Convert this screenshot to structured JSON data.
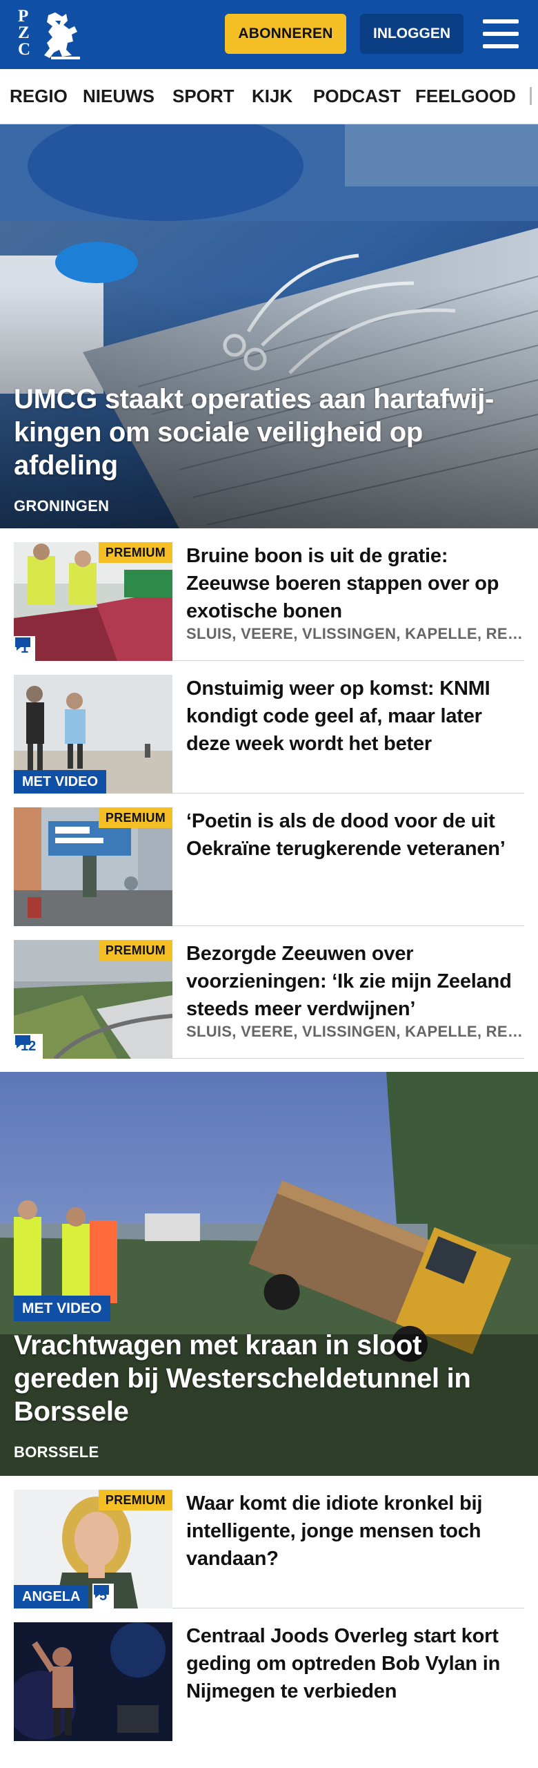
{
  "header": {
    "logo_letters": [
      "P",
      "Z",
      "C"
    ],
    "subscribe_label": "ABONNEREN",
    "login_label": "INLOGGEN",
    "brand_color": "#0f4fa6",
    "accent_color": "#f5c026"
  },
  "nav": {
    "items": [
      "REGIO",
      "NIEUWS",
      "SPORT",
      "KIJK",
      "PODCAST",
      "FEELGOOD"
    ]
  },
  "hero": {
    "title": "UMCG staakt operaties aan hartafwij-kingen om sociale veiligheid op afdeling",
    "tag": "GRONINGEN"
  },
  "articles": [
    {
      "title": "Bruine boon is uit de gratie: Zeeuwse boeren stappen over op exotische bonen",
      "meta": "SLUIS, VEERE, VLISSINGEN, KAPELLE, REIMERSWAAL",
      "premium": "PREMIUM",
      "comments": "1"
    },
    {
      "title": "Onstuimig weer op komst: KNMI kondigt code geel af, maar later deze week wordt het beter",
      "video": "MET VIDEO"
    },
    {
      "title": "‘Poetin is als de dood voor de uit Oekraïne terugkerende veteranen’",
      "premium": "PREMIUM"
    },
    {
      "title": "Bezorgde Zeeuwen over voorzieningen: ‘Ik zie mijn Zeeland steeds meer verdwijnen’",
      "meta": "SLUIS, VEERE, VLISSINGEN, KAPELLE, REIMERSWAAL",
      "premium": "PREMIUM",
      "comments": "12"
    }
  ],
  "hero2": {
    "video": "MET VIDEO",
    "title": "Vrachtwagen met kraan in sloot gereden bij Westerscheldetunnel in Borssele",
    "tag": "BORSSELE"
  },
  "articles2": [
    {
      "title": "Waar komt die idiote kronkel bij intelligente, jonge mensen toch vandaan?",
      "premium": "PREMIUM",
      "author": "ANGELA",
      "comments": "5"
    },
    {
      "title": "Centraal Joods Overleg start kort geding om optreden Bob Vylan in Nijmegen te verbieden"
    }
  ]
}
